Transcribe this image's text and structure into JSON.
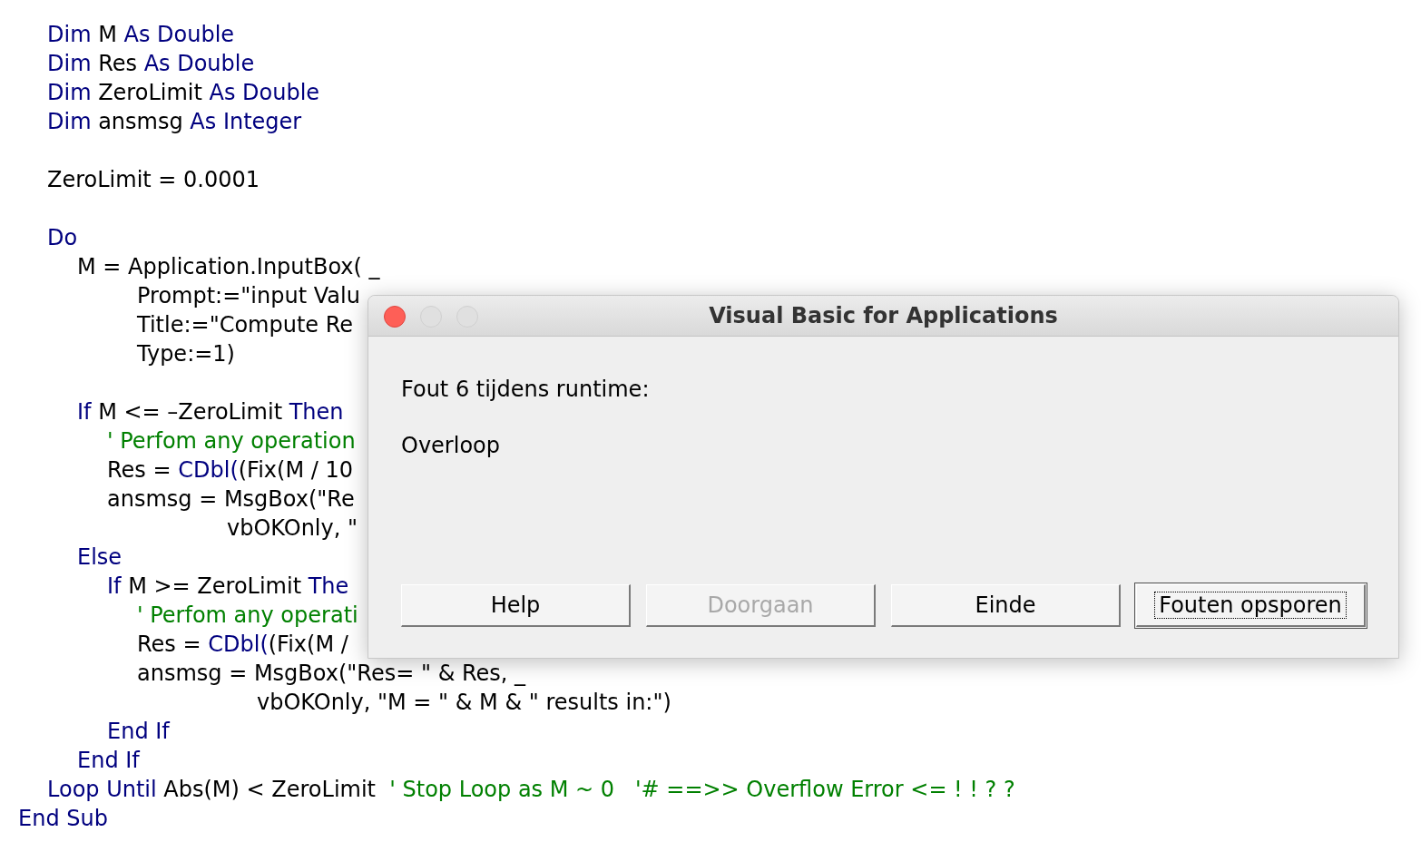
{
  "procedure": {
    "body": [
      {
        "segments": [
          {
            "kind": "keyword",
            "text": "Dim"
          },
          {
            "kind": "plain",
            "text": " M "
          },
          {
            "kind": "keyword",
            "text": "As Double"
          }
        ]
      },
      {
        "segments": [
          {
            "kind": "keyword",
            "text": "Dim"
          },
          {
            "kind": "plain",
            "text": " Res "
          },
          {
            "kind": "keyword",
            "text": "As Double"
          }
        ]
      },
      {
        "segments": [
          {
            "kind": "keyword",
            "text": "Dim"
          },
          {
            "kind": "plain",
            "text": " ZeroLimit "
          },
          {
            "kind": "keyword",
            "text": "As Double"
          }
        ]
      },
      {
        "segments": [
          {
            "kind": "keyword",
            "text": "Dim"
          },
          {
            "kind": "plain",
            "text": " ansmsg "
          },
          {
            "kind": "keyword",
            "text": "As Integer"
          }
        ]
      },
      {
        "gap_before": true,
        "segments": [
          {
            "kind": "plain",
            "text": "ZeroLimit = 0.0001"
          }
        ]
      },
      {
        "gap_before": true,
        "segments": [
          {
            "kind": "keyword",
            "text": "Do"
          }
        ],
        "children": [
          {
            "segments": [
              {
                "kind": "plain",
                "text": "M = Application.InputBox( _"
              }
            ],
            "continuation": {
              "kind": "arguments",
              "lines": [
                {
                  "segments": [
                    {
                      "kind": "plain",
                      "text": "Prompt:=\"input Valu"
                    }
                  ]
                },
                {
                  "segments": [
                    {
                      "kind": "plain",
                      "text": "Title:=\"Compute Re"
                    }
                  ]
                },
                {
                  "segments": [
                    {
                      "kind": "plain",
                      "text": "Type:=1)"
                    }
                  ]
                }
              ]
            }
          },
          {
            "gap_before": true,
            "segments": [
              {
                "kind": "keyword",
                "text": "If"
              },
              {
                "kind": "plain",
                "text": " M <= –ZeroLimit "
              },
              {
                "kind": "keyword",
                "text": "Then"
              }
            ],
            "children": [
              {
                "segments": [
                  {
                    "kind": "comment",
                    "text": "' Perfom any operation"
                  }
                ]
              },
              {
                "segments": [
                  {
                    "kind": "plain",
                    "text": "Res = "
                  },
                  {
                    "kind": "keyword",
                    "text": "CDbl("
                  },
                  {
                    "kind": "plain",
                    "text": "(Fix(M / 10"
                  }
                ]
              },
              {
                "segments": [
                  {
                    "kind": "plain",
                    "text": "ansmsg = MsgBox(\"Re"
                  }
                ],
                "continuation": {
                  "kind": "wrapped",
                  "lines": [
                    {
                      "segments": [
                        {
                          "kind": "plain",
                          "text": "vbOKOnly, \""
                        }
                      ]
                    }
                  ]
                }
              }
            ]
          },
          {
            "segments": [
              {
                "kind": "keyword",
                "text": "Else"
              }
            ],
            "children": [
              {
                "segments": [
                  {
                    "kind": "keyword",
                    "text": "If"
                  },
                  {
                    "kind": "plain",
                    "text": " M >= ZeroLimit "
                  },
                  {
                    "kind": "keyword",
                    "text": "The"
                  }
                ],
                "children": [
                  {
                    "segments": [
                      {
                        "kind": "comment",
                        "text": "' Perfom any operati"
                      }
                    ]
                  },
                  {
                    "segments": [
                      {
                        "kind": "plain",
                        "text": "Res = "
                      },
                      {
                        "kind": "keyword",
                        "text": "CDbl("
                      },
                      {
                        "kind": "plain",
                        "text": "(Fix(M /"
                      }
                    ]
                  },
                  {
                    "segments": [
                      {
                        "kind": "plain",
                        "text": "ansmsg = MsgBox(\"Res= \" & Res, _"
                      }
                    ],
                    "continuation": {
                      "kind": "wrapped",
                      "lines": [
                        {
                          "segments": [
                            {
                              "kind": "plain",
                              "text": "vbOKOnly, \"M = \" & M & \" results in:\")"
                            }
                          ]
                        }
                      ]
                    }
                  }
                ]
              },
              {
                "segments": [
                  {
                    "kind": "keyword",
                    "text": "End If"
                  }
                ]
              }
            ]
          },
          {
            "segments": [
              {
                "kind": "keyword",
                "text": "End If"
              }
            ]
          }
        ]
      },
      {
        "segments": [
          {
            "kind": "keyword",
            "text": "Loop Until"
          },
          {
            "kind": "plain",
            "text": " Abs(M) < ZeroLimit  "
          },
          {
            "kind": "comment",
            "text": "' Stop Loop as M ~ 0   '# ==>> Overflow Error <= ! ! ? ?"
          }
        ]
      }
    ],
    "footer": {
      "segments": [
        {
          "kind": "keyword",
          "text": "End Sub"
        }
      ]
    }
  },
  "dialog": {
    "title": "Visual Basic for Applications",
    "message": "Fout 6 tijdens runtime:",
    "detail": "Overloop",
    "buttons": [
      {
        "label": "Help",
        "disabled": false,
        "default": false
      },
      {
        "label": "Doorgaan",
        "disabled": true,
        "default": false
      },
      {
        "label": "Einde",
        "disabled": false,
        "default": false
      },
      {
        "label": "Fouten opsporen",
        "disabled": false,
        "default": true
      }
    ]
  }
}
